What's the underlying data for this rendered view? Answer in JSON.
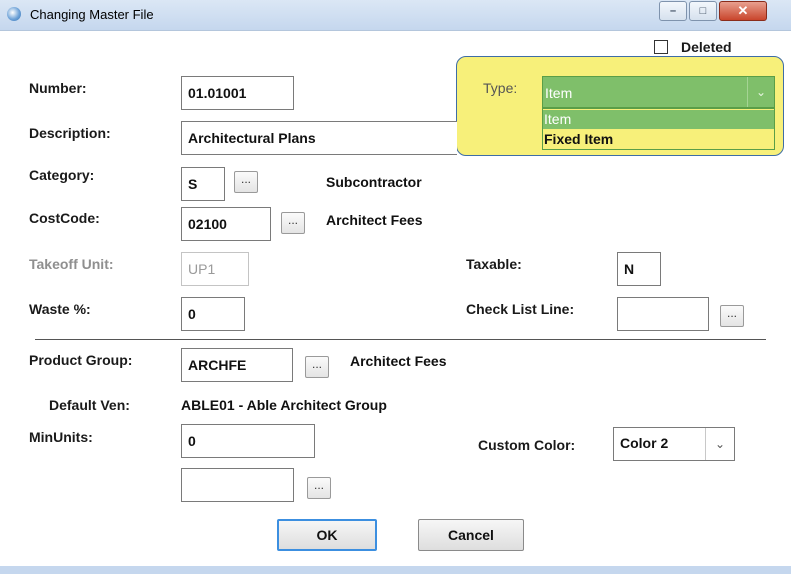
{
  "window": {
    "title": "Changing Master File",
    "icon": "app-icon",
    "controls": {
      "minimize": "–",
      "maximize": "□",
      "close": "✕"
    }
  },
  "deleted": {
    "label": "Deleted",
    "checked": false
  },
  "type": {
    "label": "Type:",
    "value": "Item",
    "options": [
      "Item",
      "Fixed Item"
    ],
    "highlight_color": "#f7f07a",
    "accent": "#7fbf6a"
  },
  "fields": {
    "number": {
      "label": "Number:",
      "value": "01.01001"
    },
    "description": {
      "label": "Description:",
      "value": "Architectural Plans"
    },
    "category": {
      "label": "Category:",
      "value": "S",
      "lookup": "...",
      "name": "Subcontractor"
    },
    "costcode": {
      "label": "CostCode:",
      "value": "02100",
      "lookup": "...",
      "name": "Architect Fees"
    },
    "takeoff_unit": {
      "label": "Takeoff Unit:",
      "value": "UP1"
    },
    "taxable": {
      "label": "Taxable:",
      "value": "N"
    },
    "waste": {
      "label": "Waste %:",
      "value": "0"
    },
    "check_list_line": {
      "label": "Check List Line:",
      "value": "",
      "lookup": "..."
    },
    "product_group": {
      "label": "Product Group:",
      "value": "ARCHFE",
      "lookup": "...",
      "name": "Architect Fees"
    },
    "default_vendor": {
      "label": "Default Ven:",
      "value": "ABLE01 - Able Architect Group"
    },
    "min_units": {
      "label": "MinUnits:",
      "value": "0"
    },
    "extra": {
      "value": "",
      "lookup": "..."
    },
    "custom_color": {
      "label": "Custom Color:",
      "value": "Color 2"
    }
  },
  "buttons": {
    "ok": "OK",
    "cancel": "Cancel"
  }
}
